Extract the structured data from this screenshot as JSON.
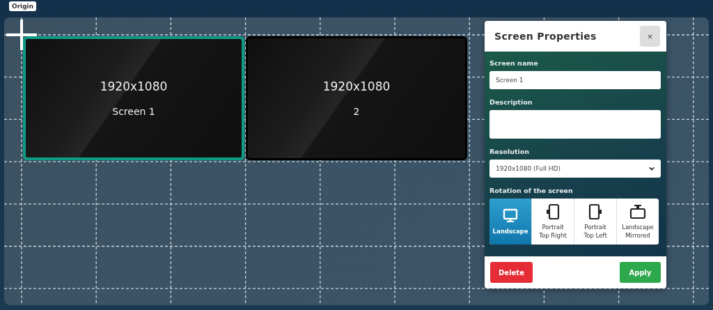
{
  "origin_tooltip": "Origin",
  "screens": [
    {
      "resolution": "1920x1080",
      "name": "Screen 1",
      "selected": true
    },
    {
      "resolution": "1920x1080",
      "name": "2",
      "selected": false
    }
  ],
  "properties": {
    "title": "Screen Properties",
    "close": "×",
    "fields": [
      {
        "label": "Screen name",
        "kind": "input",
        "value": "Screen 1"
      },
      {
        "label": "Description",
        "kind": "textarea"
      },
      {
        "label": "Resolution",
        "kind": "select",
        "value": "1920x1080 (Full HD)"
      }
    ],
    "rotation": {
      "label": "Rotation of the screen",
      "options": [
        {
          "label": "Landscape",
          "kind": "landscape",
          "selected": true
        },
        {
          "label": "Portrait\nTop Right",
          "kind": "portrait_right",
          "selected": false
        },
        {
          "label": "Portrait\nTop Left",
          "kind": "portrait_left",
          "selected": false
        },
        {
          "label": "Landscape\nMirrored",
          "kind": "landscape_mirrored",
          "selected": false
        }
      ]
    },
    "buttons": [
      {
        "label": "Delete",
        "kind": "danger"
      },
      {
        "label": "Apply",
        "kind": "success"
      }
    ]
  }
}
